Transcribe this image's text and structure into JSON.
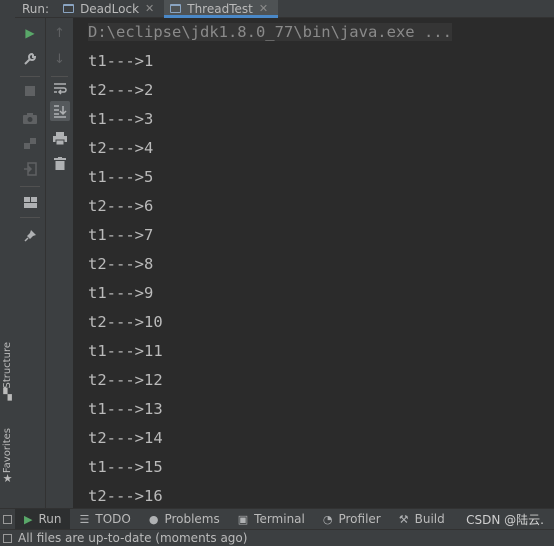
{
  "run_header": {
    "title": "Run:",
    "tabs": [
      {
        "label": "DeadLock",
        "active": false
      },
      {
        "label": "ThreadTest",
        "active": true
      }
    ]
  },
  "left_stripe": {
    "structure_label": "Structure",
    "favorites_label": "Favorites"
  },
  "toolbar_primary": [
    {
      "name": "rerun",
      "icon": "play-icon",
      "glyph": "▶"
    },
    {
      "name": "modify-run-config",
      "icon": "wrench-icon",
      "glyph": "🔧"
    },
    {
      "name": "stop",
      "icon": "stop-icon",
      "glyph": "■"
    },
    {
      "name": "dump-threads",
      "icon": "camera-icon",
      "glyph": "📷"
    },
    {
      "name": "restore-layout",
      "icon": "restore-icon",
      "glyph": "⤺"
    },
    {
      "name": "exit",
      "icon": "exit-icon",
      "glyph": "⇥"
    },
    {
      "name": "layout",
      "icon": "layout-icon",
      "glyph": "▦"
    },
    {
      "name": "pin",
      "icon": "pin-icon",
      "glyph": "📌"
    }
  ],
  "toolbar_secondary": [
    {
      "name": "scroll-up",
      "icon": "arrow-up-icon",
      "glyph": "↑"
    },
    {
      "name": "scroll-down",
      "icon": "arrow-down-icon",
      "glyph": "↓"
    },
    {
      "name": "soft-wrap",
      "icon": "soft-wrap-icon",
      "glyph": "↵"
    },
    {
      "name": "scroll-to-end",
      "icon": "scroll-to-end-icon",
      "glyph": "⤓"
    },
    {
      "name": "print",
      "icon": "print-icon",
      "glyph": "⎙"
    },
    {
      "name": "clear-all",
      "icon": "trash-icon",
      "glyph": "🗑"
    }
  ],
  "console": {
    "command": "D:\\eclipse\\jdk1.8.0_77\\bin\\java.exe ...",
    "lines": [
      "t1--->1",
      "t2--->2",
      "t1--->3",
      "t2--->4",
      "t1--->5",
      "t2--->6",
      "t1--->7",
      "t2--->8",
      "t1--->9",
      "t2--->10",
      "t1--->11",
      "t2--->12",
      "t1--->13",
      "t2--->14",
      "t1--->15",
      "t2--->16"
    ]
  },
  "bottom_bar": {
    "items": [
      {
        "label": "Run",
        "icon": "run-icon",
        "active": true
      },
      {
        "label": "TODO",
        "icon": "todo-icon",
        "active": false
      },
      {
        "label": "Problems",
        "icon": "problems-icon",
        "active": false
      },
      {
        "label": "Terminal",
        "icon": "terminal-icon",
        "active": false
      },
      {
        "label": "Profiler",
        "icon": "profiler-icon",
        "active": false
      },
      {
        "label": "Build",
        "icon": "build-icon",
        "active": false
      }
    ],
    "watermark": "CSDN @陆云."
  },
  "status_bar": {
    "text": "All files are up-to-date (moments ago)"
  },
  "colors": {
    "background": "#2b2b2b",
    "panel": "#3c3f41",
    "accent": "#4a88c7",
    "run_green": "#59a869"
  }
}
